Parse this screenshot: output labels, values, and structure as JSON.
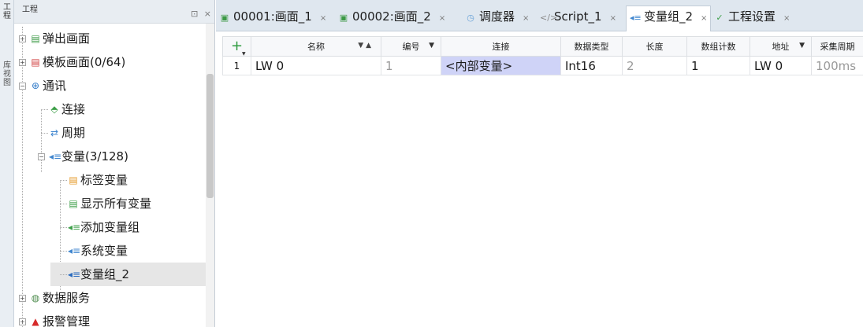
{
  "side_strip": {
    "label_top": "工程",
    "label_mid": "库视图"
  },
  "project_panel": {
    "title": "工程",
    "controls": "⊡ ×"
  },
  "tree": [
    {
      "id": "popup",
      "label": "弹出画面",
      "icon": "screen-icon",
      "glyph": "▤",
      "color": "#3c9a46",
      "expander": "+"
    },
    {
      "id": "template",
      "label": "模板画面(0/64)",
      "icon": "template-icon",
      "glyph": "▤",
      "color": "#d04040",
      "expander": "+"
    },
    {
      "id": "comm",
      "label": "通讯",
      "icon": "globe-icon",
      "glyph": "⊕",
      "color": "#2f79c8",
      "expander": "−"
    },
    {
      "id": "connection",
      "label": "连接",
      "icon": "plug-icon",
      "glyph": "⬘",
      "color": "#3fa04a"
    },
    {
      "id": "cycle",
      "label": "周期",
      "icon": "cycle-icon",
      "glyph": "⇄",
      "color": "#3f86cf"
    },
    {
      "id": "variables",
      "label": "变量(3/128)",
      "icon": "variable-icon",
      "glyph": "◂≡",
      "color": "#3f86cf",
      "expander": "−"
    },
    {
      "id": "tag-vars",
      "label": "标签变量",
      "icon": "tag-variable-icon",
      "glyph": "▤",
      "color": "#e59a2a"
    },
    {
      "id": "show-all",
      "label": "显示所有变量",
      "icon": "show-all-icon",
      "glyph": "▤",
      "color": "#3fa04a"
    },
    {
      "id": "add-group",
      "label": "添加变量组",
      "icon": "add-group-icon",
      "glyph": "◂≡",
      "color": "#3fa04a"
    },
    {
      "id": "system-vars",
      "label": "系统变量",
      "icon": "system-variable-icon",
      "glyph": "◂≡",
      "color": "#3f86cf"
    },
    {
      "id": "group-2",
      "label": "变量组_2",
      "icon": "variable-group-icon",
      "glyph": "◂≡",
      "color": "#2b6cbf",
      "selected": true
    },
    {
      "id": "data-service",
      "label": "数据服务",
      "icon": "data-service-icon",
      "glyph": "◍",
      "color": "#4e8c4e",
      "expander": "+"
    },
    {
      "id": "alarm",
      "label": "报警管理",
      "icon": "alarm-icon",
      "glyph": "▲",
      "color": "#d62b2b",
      "expander": "+"
    }
  ],
  "tabs": [
    {
      "label": "00001:画面_1",
      "icon": "screen-icon",
      "glyph": "▣",
      "color": "#3c9a46",
      "close": "×"
    },
    {
      "label": "00002:画面_2",
      "icon": "screen-icon",
      "glyph": "▣",
      "color": "#3c9a46",
      "close": "×"
    },
    {
      "label": "调度器",
      "icon": "scheduler-icon",
      "glyph": "◷",
      "color": "#6aa3d8",
      "close": "×"
    },
    {
      "label": "Script_1",
      "icon": "script-icon",
      "glyph": "</>",
      "color": "#8a8a8a",
      "close": "×"
    },
    {
      "label": "变量组_2",
      "icon": "variable-group-icon",
      "glyph": "◂≡",
      "color": "#3f86cf",
      "close": "×",
      "active": true
    },
    {
      "label": "工程设置",
      "icon": "settings-icon",
      "glyph": "✓",
      "color": "#3fa04a",
      "close": "×"
    }
  ],
  "grid": {
    "add_button": "+",
    "columns": [
      "名称",
      "编号",
      "连接",
      "数据类型",
      "长度",
      "数组计数",
      "地址",
      "采集周期"
    ],
    "rows": [
      {
        "num": "1",
        "name": "LW 0",
        "id": "1",
        "connection": "<内部变量>",
        "type": "Int16",
        "length": "2",
        "count": "1",
        "address": "LW 0",
        "cycle": "100ms"
      }
    ]
  }
}
